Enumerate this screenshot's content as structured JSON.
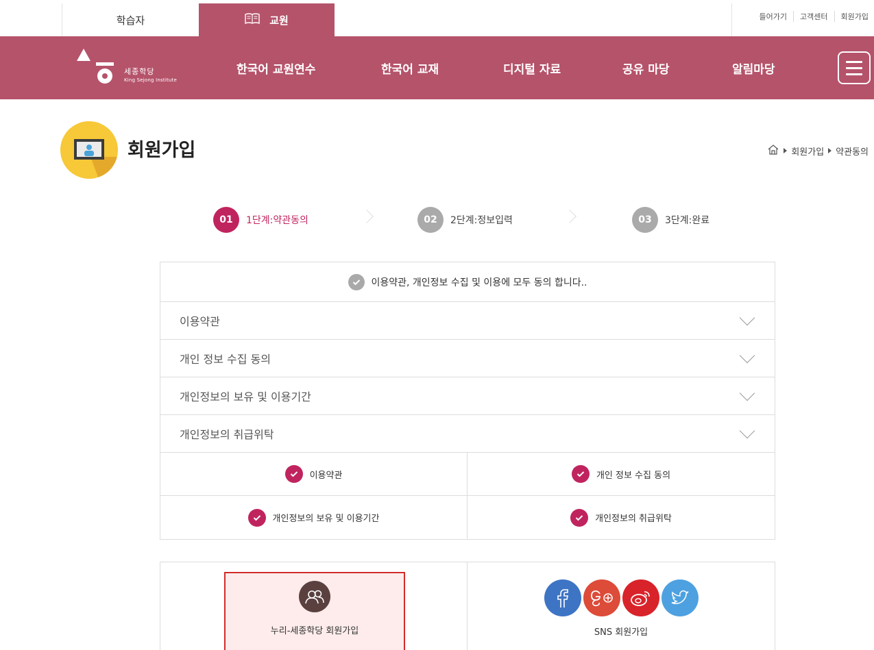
{
  "topbar": {
    "tab_learner": "학습자",
    "tab_teacher": "교원",
    "util_links": [
      "들어가기",
      "고객센터",
      "회원가입"
    ]
  },
  "header": {
    "logo_main": "세종학당",
    "logo_sub": "King Sejong Institute",
    "nav": [
      "한국어 교원연수",
      "한국어 교재",
      "디지털 자료",
      "공유 마당",
      "알림마당"
    ],
    "menu_icon": "hamburger-icon"
  },
  "page": {
    "title": "회원가입",
    "breadcrumb": [
      "회원가입",
      "약관동의"
    ]
  },
  "steps": [
    {
      "num": "01",
      "label": "1단계:약관동의",
      "active": true
    },
    {
      "num": "02",
      "label": "2단계:정보입력",
      "active": false
    },
    {
      "num": "03",
      "label": "3단계:완료",
      "active": false
    }
  ],
  "agreement": {
    "agree_all": "이용약관, 개인정보 수집 및 이용에 모두 동의 합니다..",
    "sections": [
      "이용약관",
      "개인 정보 수집 동의",
      "개인정보의 보유 및 이용기간",
      "개인정보의 취급위탁"
    ],
    "checks": [
      "이용약관",
      "개인 정보 수집 동의",
      "개인정보의 보유 및 이용기간",
      "개인정보의 취급위탁"
    ]
  },
  "join": {
    "nuri_label": "누리-세종학당 회원가입",
    "sns_label": "SNS 회원가입",
    "sns_icons": [
      "facebook-icon",
      "google-plus-icon",
      "weibo-icon",
      "twitter-icon"
    ]
  },
  "colors": {
    "brand": "#b5536a",
    "active_step": "#c0245e",
    "inactive_step": "#aaaaaa",
    "highlight_border": "#d22a2a"
  }
}
